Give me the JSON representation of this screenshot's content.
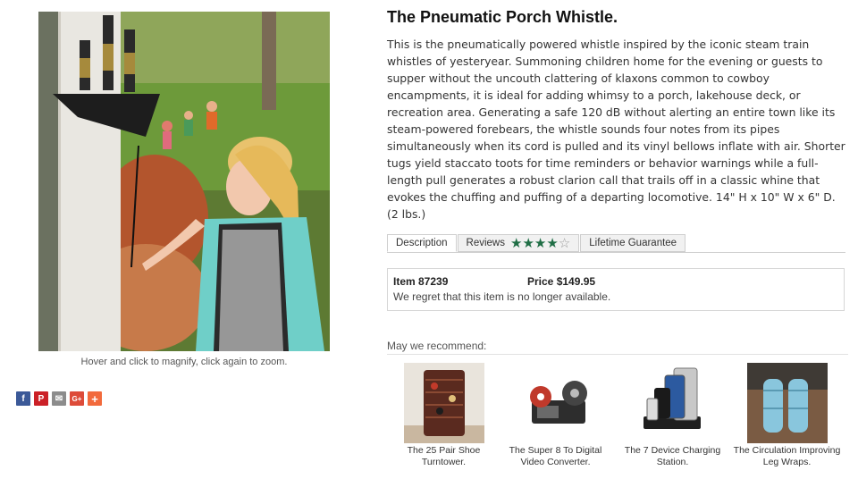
{
  "product": {
    "title": "The Pneumatic Porch Whistle.",
    "description": "This is the pneumatically powered whistle inspired by the iconic steam train whistles of yesteryear. Summoning children home for the evening or guests to supper without the uncouth clattering of klaxons common to cowboy encampments, it is ideal for adding whimsy to a porch, lakehouse deck, or recreation area. Generating a safe 120 dB without alerting an entire town like its steam-powered forebears, the whistle sounds four notes from its pipes simultaneously when its cord is pulled and its vinyl bellows inflate with air. Shorter tugs yield staccato toots for time reminders or behavior warnings while a full-length pull generates a robust clarion call that trails off in a classic whine that evokes the chuffing and puffing of a departing locomotive. 14\" H x 10\" W x 6\" D. (2 lbs.)",
    "magnify_hint": "Hover and click to magnify, click again to zoom."
  },
  "share": {
    "buttons": [
      {
        "icon": "facebook-icon",
        "glyph": "f",
        "color": "#3b5998"
      },
      {
        "icon": "pinterest-icon",
        "glyph": "P",
        "color": "#cb2027"
      },
      {
        "icon": "email-icon",
        "glyph": "✉",
        "color": "#8c8c8c"
      },
      {
        "icon": "google-plus-icon",
        "glyph": "G+",
        "color": "#dd4b39"
      },
      {
        "icon": "more-icon",
        "glyph": "+",
        "color": "#f26a3c"
      }
    ]
  },
  "tabs": {
    "description": "Description",
    "reviews": "Reviews",
    "rating": 4,
    "rating_max": 5,
    "guarantee": "Lifetime Guarantee",
    "star_color": "#1f6e45"
  },
  "item": {
    "number": "Item 87239",
    "price": "Price $149.95",
    "message": "We regret that this item is no longer available."
  },
  "recommend": {
    "heading": "May we recommend:",
    "items": [
      {
        "caption": "The 25 Pair Shoe Turntower."
      },
      {
        "caption": "The Super 8 To Digital Video Converter."
      },
      {
        "caption": "The 7 Device Charging Station."
      },
      {
        "caption": "The Circulation Improving Leg Wraps."
      }
    ]
  }
}
